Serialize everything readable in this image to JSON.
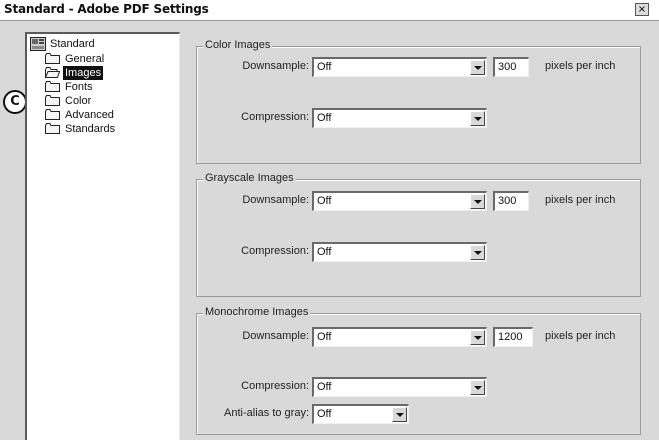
{
  "window": {
    "title": "Standard - Adobe PDF Settings",
    "close_label": "×"
  },
  "callout": {
    "letter": "C"
  },
  "tree": {
    "root": "Standard",
    "items": [
      {
        "label": "General",
        "selected": false
      },
      {
        "label": "Images",
        "selected": true
      },
      {
        "label": "Fonts",
        "selected": false
      },
      {
        "label": "Color",
        "selected": false
      },
      {
        "label": "Advanced",
        "selected": false
      },
      {
        "label": "Standards",
        "selected": false
      }
    ]
  },
  "color_images": {
    "legend": "Color Images",
    "downsample_label": "Downsample:",
    "downsample_value": "Off",
    "resolution": "300",
    "unit": "pixels per inch",
    "compression_label": "Compression:",
    "compression_value": "Off"
  },
  "grayscale_images": {
    "legend": "Grayscale Images",
    "downsample_label": "Downsample:",
    "downsample_value": "Off",
    "resolution": "300",
    "unit": "pixels per inch",
    "compression_label": "Compression:",
    "compression_value": "Off"
  },
  "monochrome_images": {
    "legend": "Monochrome Images",
    "downsample_label": "Downsample:",
    "downsample_value": "Off",
    "resolution": "1200",
    "unit": "pixels per inch",
    "compression_label": "Compression:",
    "compression_value": "Off",
    "antialias_label": "Anti-alias to gray:",
    "antialias_value": "Off"
  }
}
